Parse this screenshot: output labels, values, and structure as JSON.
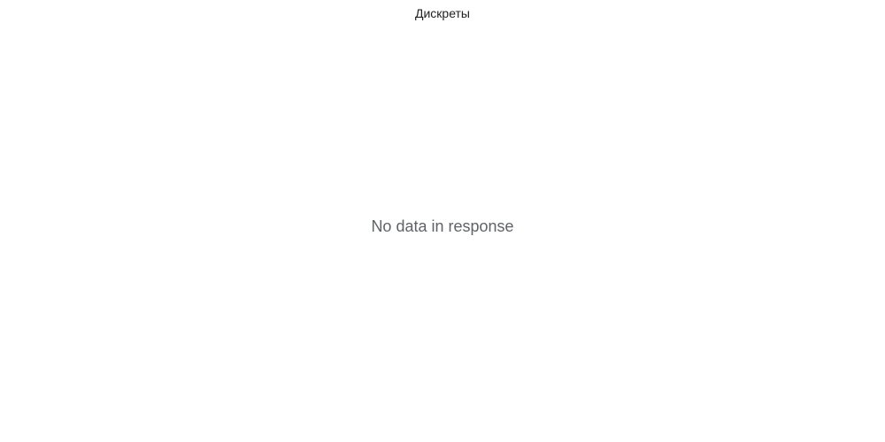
{
  "chart_data": {
    "type": "line",
    "title": "Дискреты",
    "series": [],
    "message": "No data in response"
  }
}
